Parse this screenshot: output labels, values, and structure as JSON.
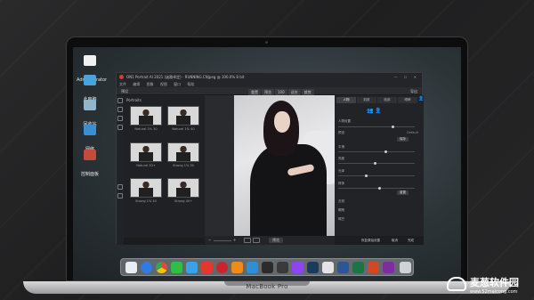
{
  "desktop": {
    "icons": [
      {
        "label": "Administrator",
        "color": "#f1f1f1"
      },
      {
        "label": "此电脑",
        "color": "#4aa3df"
      },
      {
        "label": "回收站",
        "color": "#8fb7c9"
      },
      {
        "label": "网络",
        "color": "#3b8ed1"
      },
      {
        "label": "控制面板",
        "color": "#c64a3a"
      }
    ]
  },
  "app": {
    "title": "ON1 Portrait AI 2021 (迷雅卓定) - RUNNING.CNjpeg @ 100.0% 8 bit",
    "window_controls": "— ☐ ✕",
    "menu": [
      "文件",
      "编辑",
      "图像",
      "视图",
      "窗口",
      "帮助"
    ],
    "toolbar": {
      "left_label": "预设",
      "tools": [
        "重置",
        "预览",
        "100",
        "适合",
        "裁剪"
      ],
      "right_label": "导出"
    },
    "presets_header": "Portraits",
    "presets": [
      {
        "label": "Natural 1% 30"
      },
      {
        "label": "Natural 1% 40"
      },
      {
        "label": "Natural 30+"
      },
      {
        "label": "Strong 1% 30"
      },
      {
        "label": "Strong 1% 40"
      },
      {
        "label": "Strong 40+"
      }
    ],
    "right_panel": {
      "tabs": [
        "人物",
        "肌肤",
        "脸部",
        "眼睛"
      ],
      "user_icon": "👤",
      "face_icons": "👥 👤",
      "rows": [
        {
          "label": "人物设置",
          "value": ""
        },
        {
          "label": "预设",
          "value": "Default"
        },
        {
          "label": "平滑",
          "value": ""
        },
        {
          "label": "亮度",
          "value": ""
        },
        {
          "label": "光泽",
          "value": ""
        },
        {
          "label": "修饰",
          "value": ""
        },
        {
          "label": "去斑",
          "value": ""
        },
        {
          "label": "眼睛",
          "value": ""
        },
        {
          "label": "嘴巴",
          "value": ""
        }
      ],
      "buttons": [
        "保存",
        "重置"
      ],
      "footer": [
        "恢复原始设置",
        "取消",
        "完成"
      ]
    },
    "canvas_footer": {
      "zoom_minus": "−",
      "zoom_plus": "+",
      "preview_label": "预览"
    }
  },
  "dock": {
    "apps": [
      {
        "name": "finder",
        "color": "#e9eef3"
      },
      {
        "name": "safari",
        "color": "#2d7be5"
      },
      {
        "name": "chrome",
        "color": "#e04a3a"
      },
      {
        "name": "wechat",
        "color": "#2fbf45"
      },
      {
        "name": "qq",
        "color": "#3aa2e8"
      },
      {
        "name": "weibo",
        "color": "#e6372c"
      },
      {
        "name": "netease-music",
        "color": "#c9242b"
      },
      {
        "name": "vlc",
        "color": "#f08a1b"
      },
      {
        "name": "vscode",
        "color": "#2c8fd8"
      },
      {
        "name": "github",
        "color": "#2b2b2b"
      },
      {
        "name": "terminal",
        "color": "#3a3a3a"
      },
      {
        "name": "twitch",
        "color": "#8d45f2"
      },
      {
        "name": "steam",
        "color": "#1a3c5a"
      },
      {
        "name": "java",
        "color": "#e4e4e4"
      },
      {
        "name": "word",
        "color": "#2b5797"
      },
      {
        "name": "excel",
        "color": "#1f7244"
      },
      {
        "name": "powerpoint",
        "color": "#d24726"
      },
      {
        "name": "onenote",
        "color": "#7b2f9c"
      },
      {
        "name": "trash",
        "color": "#cfd3d7"
      }
    ]
  },
  "laptop": {
    "model": "MacBook Pro"
  },
  "watermark": {
    "name": "麦葱软件园",
    "url": "www.52maicong.com"
  }
}
